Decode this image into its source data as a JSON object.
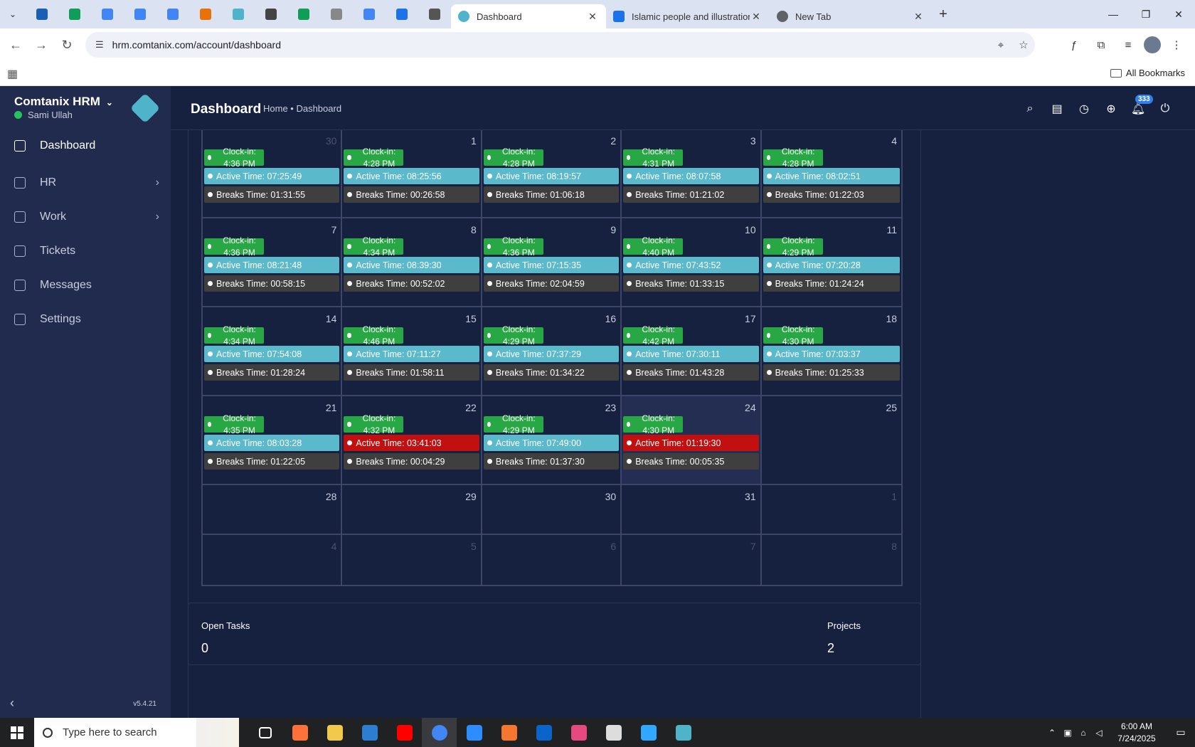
{
  "browser": {
    "tabs": [
      {
        "label": "Dashboard",
        "active": true,
        "fav_color": "#4fb3c9"
      },
      {
        "label": "Islamic people and illustration v",
        "active": false,
        "fav_color": "#1a73e8"
      },
      {
        "label": "New Tab",
        "active": false,
        "fav_color": "#5f6368"
      }
    ],
    "pinned_colors": [
      "#1a5fb4",
      "#0f9d58",
      "#4285f4",
      "#4285f4",
      "#4285f4",
      "#e8710a",
      "#4fb3c9",
      "#444444",
      "#0f9d58",
      "#888888",
      "#4285f4",
      "#1a73e8",
      "#555555"
    ],
    "url": "hrm.comtanix.com/account/dashboard",
    "bookmarks_all": "All Bookmarks"
  },
  "app": {
    "brand": "Comtanix HRM",
    "user": "Sami Ullah",
    "version": "v5.4.21",
    "nav": [
      {
        "label": "Dashboard",
        "icon": "home-icon",
        "active": true,
        "has_children": false
      },
      {
        "label": "HR",
        "icon": "users-icon",
        "active": false,
        "has_children": true
      },
      {
        "label": "Work",
        "icon": "briefcase-icon",
        "active": false,
        "has_children": true
      },
      {
        "label": "Tickets",
        "icon": "headset-icon",
        "active": false,
        "has_children": false
      },
      {
        "label": "Messages",
        "icon": "message-icon",
        "active": false,
        "has_children": false
      },
      {
        "label": "Settings",
        "icon": "gear-icon",
        "active": false,
        "has_children": false
      }
    ],
    "page_title": "Dashboard",
    "breadcrumb": "Home • Dashboard",
    "notification_count": "333"
  },
  "calendar": {
    "weeks": [
      [
        {
          "day": "30",
          "dim": true,
          "events": [
            [
              "clock",
              "Clock-in: 4:36 PM"
            ],
            [
              "active",
              "Active Time: 07:25:49"
            ],
            [
              "breaks",
              "Breaks Time: 01:31:55"
            ]
          ]
        },
        {
          "day": "1",
          "events": [
            [
              "clock",
              "Clock-in: 4:28 PM"
            ],
            [
              "active",
              "Active Time: 08:25:56"
            ],
            [
              "breaks",
              "Breaks Time: 00:26:58"
            ]
          ]
        },
        {
          "day": "2",
          "events": [
            [
              "clock",
              "Clock-in: 4:28 PM"
            ],
            [
              "active",
              "Active Time: 08:19:57"
            ],
            [
              "breaks",
              "Breaks Time: 01:06:18"
            ]
          ]
        },
        {
          "day": "3",
          "events": [
            [
              "clock",
              "Clock-in: 4:31 PM"
            ],
            [
              "active",
              "Active Time: 08:07:58"
            ],
            [
              "breaks",
              "Breaks Time: 01:21:02"
            ]
          ]
        },
        {
          "day": "4",
          "events": [
            [
              "clock",
              "Clock-in: 4:28 PM"
            ],
            [
              "active",
              "Active Time: 08:02:51"
            ],
            [
              "breaks",
              "Breaks Time: 01:22:03"
            ]
          ]
        }
      ],
      [
        {
          "day": "7",
          "events": [
            [
              "clock",
              "Clock-in: 4:36 PM"
            ],
            [
              "active",
              "Active Time: 08:21:48"
            ],
            [
              "breaks",
              "Breaks Time: 00:58:15"
            ]
          ]
        },
        {
          "day": "8",
          "events": [
            [
              "clock",
              "Clock-in: 4:34 PM"
            ],
            [
              "active",
              "Active Time: 08:39:30"
            ],
            [
              "breaks",
              "Breaks Time: 00:52:02"
            ]
          ]
        },
        {
          "day": "9",
          "events": [
            [
              "clock",
              "Clock-in: 4:36 PM"
            ],
            [
              "active",
              "Active Time: 07:15:35"
            ],
            [
              "breaks",
              "Breaks Time: 02:04:59"
            ]
          ]
        },
        {
          "day": "10",
          "events": [
            [
              "clock",
              "Clock-in: 4:40 PM"
            ],
            [
              "active",
              "Active Time: 07:43:52"
            ],
            [
              "breaks",
              "Breaks Time: 01:33:15"
            ]
          ]
        },
        {
          "day": "11",
          "events": [
            [
              "clock",
              "Clock-in: 4:29 PM"
            ],
            [
              "active",
              "Active Time: 07:20:28"
            ],
            [
              "breaks",
              "Breaks Time: 01:24:24"
            ]
          ]
        }
      ],
      [
        {
          "day": "14",
          "events": [
            [
              "clock",
              "Clock-in: 4:34 PM"
            ],
            [
              "active",
              "Active Time: 07:54:08"
            ],
            [
              "breaks",
              "Breaks Time: 01:28:24"
            ]
          ]
        },
        {
          "day": "15",
          "events": [
            [
              "clock",
              "Clock-in: 4:46 PM"
            ],
            [
              "active",
              "Active Time: 07:11:27"
            ],
            [
              "breaks",
              "Breaks Time: 01:58:11"
            ]
          ]
        },
        {
          "day": "16",
          "events": [
            [
              "clock",
              "Clock-in: 4:29 PM"
            ],
            [
              "active",
              "Active Time: 07:37:29"
            ],
            [
              "breaks",
              "Breaks Time: 01:34:22"
            ]
          ]
        },
        {
          "day": "17",
          "events": [
            [
              "clock",
              "Clock-in: 4:42 PM"
            ],
            [
              "active",
              "Active Time: 07:30:11"
            ],
            [
              "breaks",
              "Breaks Time: 01:43:28"
            ]
          ]
        },
        {
          "day": "18",
          "events": [
            [
              "clock",
              "Clock-in: 4:30 PM"
            ],
            [
              "active",
              "Active Time: 07:03:37"
            ],
            [
              "breaks",
              "Breaks Time: 01:25:33"
            ]
          ]
        }
      ],
      [
        {
          "day": "21",
          "events": [
            [
              "clock",
              "Clock-in: 4:35 PM"
            ],
            [
              "active",
              "Active Time: 08:03:28"
            ],
            [
              "breaks",
              "Breaks Time: 01:22:05"
            ]
          ]
        },
        {
          "day": "22",
          "events": [
            [
              "clock",
              "Clock-in: 4:32 PM"
            ],
            [
              "alert",
              "Active Time: 03:41:03"
            ],
            [
              "breaks",
              "Breaks Time: 00:04:29"
            ]
          ]
        },
        {
          "day": "23",
          "events": [
            [
              "clock",
              "Clock-in: 4:29 PM"
            ],
            [
              "active",
              "Active Time: 07:49:00"
            ],
            [
              "breaks",
              "Breaks Time: 01:37:30"
            ]
          ]
        },
        {
          "day": "24",
          "today": true,
          "events": [
            [
              "clock",
              "Clock-in: 4:30 PM"
            ],
            [
              "alert",
              "Active Time: 01:19:30"
            ],
            [
              "breaks",
              "Breaks Time: 00:05:35"
            ]
          ]
        },
        {
          "day": "25",
          "events": []
        }
      ],
      [
        {
          "day": "28",
          "events": []
        },
        {
          "day": "29",
          "events": []
        },
        {
          "day": "30",
          "events": []
        },
        {
          "day": "31",
          "events": []
        },
        {
          "day": "1",
          "dim": true,
          "events": []
        }
      ],
      [
        {
          "day": "4",
          "dim": true,
          "events": []
        },
        {
          "day": "5",
          "dim": true,
          "events": []
        },
        {
          "day": "6",
          "dim": true,
          "events": []
        },
        {
          "day": "7",
          "dim": true,
          "events": []
        },
        {
          "day": "8",
          "dim": true,
          "events": []
        }
      ]
    ]
  },
  "stats": {
    "open_tasks_label": "Open Tasks",
    "open_tasks_value": "0",
    "projects_label": "Projects",
    "projects_value": "2"
  },
  "taskbar": {
    "search_placeholder": "Type here to search",
    "time": "6:00 AM",
    "date": "7/24/2025",
    "app_colors": [
      "#ff7139",
      "#f2c94c",
      "#2d7dd2",
      "#ff0000",
      "#4285f4",
      "#2d8cff",
      "#f5772f",
      "#0a64c9",
      "#e64980",
      "#dddddd",
      "#31a8ff",
      "#4fb3c9"
    ]
  },
  "colors": {
    "clock": "#28a745",
    "active": "#5bb9cc",
    "alert": "#c20f0f",
    "breaks": "#3f3f3f",
    "sidebar": "#202b4e",
    "content": "#16203f"
  }
}
